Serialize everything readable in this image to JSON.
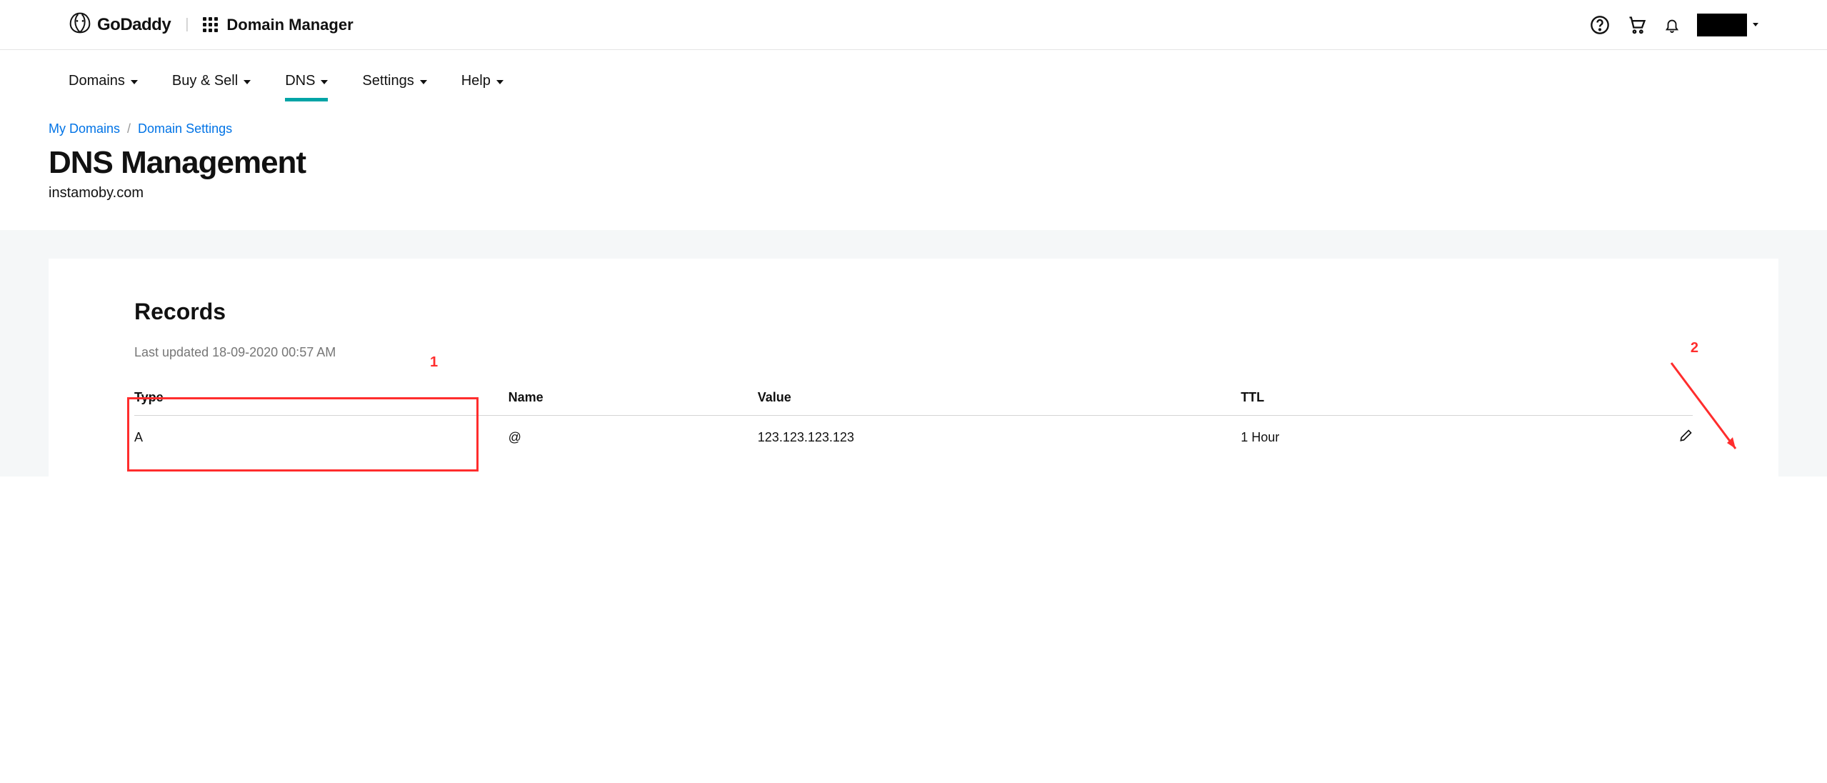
{
  "brand": "GoDaddy",
  "app_name": "Domain Manager",
  "nav": {
    "tabs": [
      {
        "label": "Domains",
        "active": false
      },
      {
        "label": "Buy & Sell",
        "active": false
      },
      {
        "label": "DNS",
        "active": true
      },
      {
        "label": "Settings",
        "active": false
      },
      {
        "label": "Help",
        "active": false
      }
    ]
  },
  "breadcrumbs": [
    {
      "label": "My Domains"
    },
    {
      "label": "Domain Settings"
    }
  ],
  "page_title": "DNS Management",
  "domain": "instamoby.com",
  "records": {
    "heading": "Records",
    "last_updated": "Last updated 18-09-2020 00:57 AM",
    "columns": {
      "type": "Type",
      "name": "Name",
      "value": "Value",
      "ttl": "TTL"
    },
    "rows": [
      {
        "type": "A",
        "name": "@",
        "value": "123.123.123.123",
        "ttl": "1 Hour"
      }
    ]
  },
  "annotations": {
    "one": "1",
    "two": "2"
  }
}
